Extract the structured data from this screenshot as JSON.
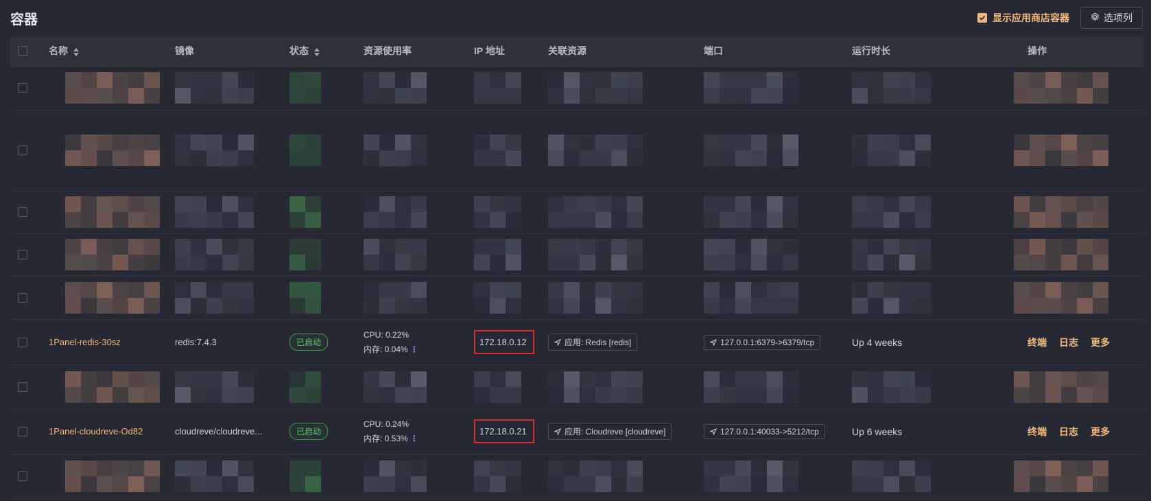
{
  "page": {
    "title": "容器"
  },
  "header": {
    "show_store_label": "显示应用商店容器",
    "show_store_checked": true,
    "columns_button_label": "选项列"
  },
  "table": {
    "columns": [
      "名称",
      "镜像",
      "状态",
      "资源使用率",
      "IP 地址",
      "关联资源",
      "端口",
      "运行时长",
      "操作"
    ],
    "sortable_columns": [
      "名称",
      "状态"
    ],
    "rows": [
      {
        "blurred": true
      },
      {
        "blurred": true
      },
      {
        "blurred": true
      },
      {
        "blurred": true
      },
      {
        "blurred": true
      },
      {
        "blurred": false,
        "name": "1Panel-redis-30sz",
        "image": "redis:7.4.3",
        "status": "已启动",
        "cpu": "CPU: 0.22%",
        "mem": "内存: 0.04%",
        "ip": "172.18.0.12",
        "resource": "应用: Redis [redis]",
        "port": "127.0.0.1:6379->6379/tcp",
        "uptime": "Up 4 weeks",
        "ops": [
          "终端",
          "日志",
          "更多"
        ]
      },
      {
        "blurred": true
      },
      {
        "blurred": false,
        "name": "1Panel-cloudreve-Od82",
        "image": "cloudreve/cloudreve...",
        "status": "已启动",
        "cpu": "CPU: 0.24%",
        "mem": "内存: 0.53%",
        "ip": "172.18.0.21",
        "resource": "应用: Cloudreve [cloudreve]",
        "port": "127.0.0.1:40033->5212/tcp",
        "uptime": "Up 6 weeks",
        "ops": [
          "终端",
          "日志",
          "更多"
        ]
      },
      {
        "blurred": true
      }
    ]
  },
  "colors": {
    "background": "#262934",
    "accent": "#f4b97d",
    "status_green": "#5cc66b",
    "highlight_box": "#d62c2c"
  },
  "icons": {
    "checkbox": "checkbox-icon",
    "gear": "gear-icon",
    "sort": "sort-icon",
    "link_arrow": "navigation-arrow-icon",
    "more_dots": "vertical-dots-icon"
  }
}
